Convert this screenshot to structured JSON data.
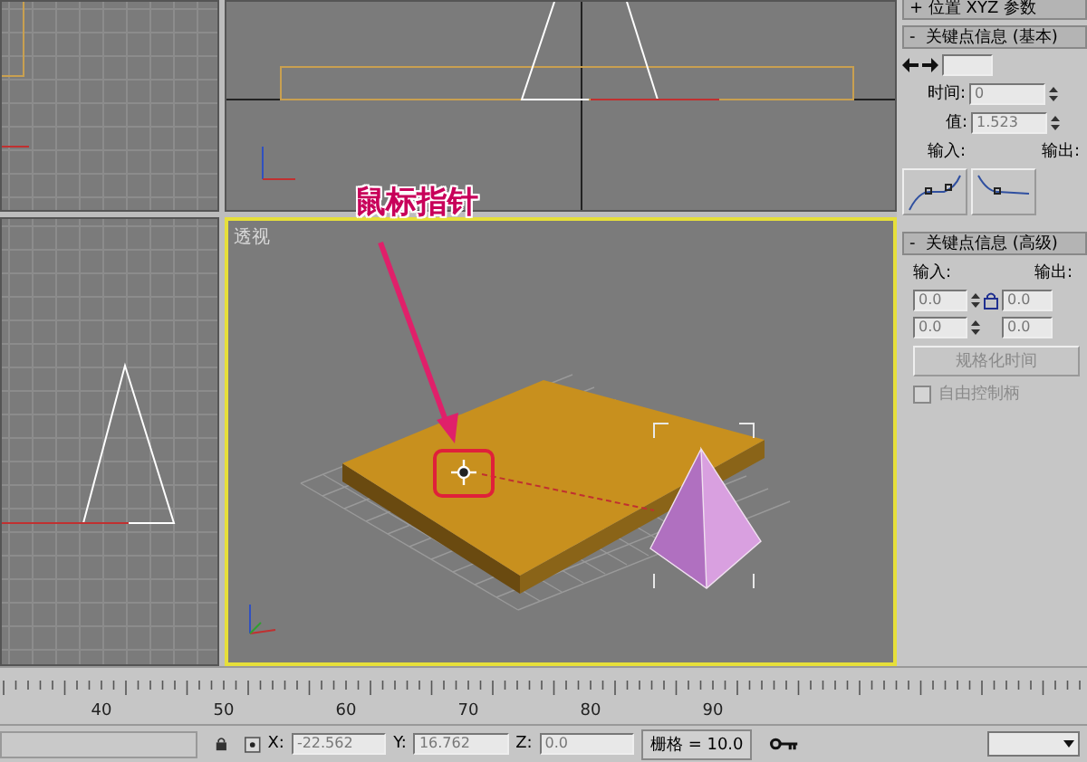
{
  "viewports": [
    {
      "kind": "left",
      "active": false
    },
    {
      "kind": "front",
      "active": false
    },
    {
      "kind": "top",
      "active": false
    },
    {
      "kind": "perspective",
      "label": "透视",
      "active": true
    }
  ],
  "annotation": {
    "text": "鼠标指针"
  },
  "panel": {
    "top_rollout": {
      "sign": "+",
      "title": "位置 XYZ 参数"
    },
    "basic": {
      "sign": "-",
      "title": "关键点信息 (基本)",
      "time_label": "时间:",
      "time_value": "0",
      "value_label": "值:",
      "value_value": "1.523",
      "in_label": "输入:",
      "out_label": "输出:"
    },
    "advanced": {
      "sign": "-",
      "title": "关键点信息 (高级)",
      "in_label": "输入:",
      "out_label": "输出:",
      "fields": [
        "0.0",
        "0.0",
        "0.0",
        "0.0"
      ],
      "normalize_button": {
        "label": "规格化时间",
        "disabled": true
      },
      "free_handle": {
        "label": "自由控制柄",
        "checked": false,
        "disabled": true
      }
    }
  },
  "ruler": {
    "labels": [
      "40",
      "50",
      "60",
      "70",
      "80",
      "90"
    ]
  },
  "status": {
    "coords": [
      {
        "axis": "X:",
        "value": "-22.562"
      },
      {
        "axis": "Y:",
        "value": "16.762"
      },
      {
        "axis": "Z:",
        "value": "0.0"
      }
    ],
    "grid": "栅格 = 10.0"
  }
}
